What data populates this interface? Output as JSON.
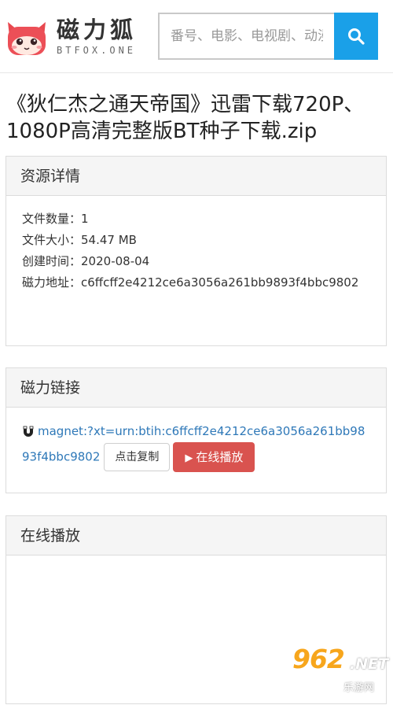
{
  "header": {
    "logo_name": "磁力狐",
    "logo_sub": "BTFOX.ONE",
    "search_placeholder": "番号、电影、电视剧、动漫"
  },
  "title": "《狄仁杰之通天帝国》迅雷下载720P、1080P高清完整版BT种子下载.zip",
  "details": {
    "heading": "资源详情",
    "rows": [
      {
        "label": "文件数量：",
        "value": "1"
      },
      {
        "label": "文件大小：",
        "value": "54.47 MB"
      },
      {
        "label": "创建时间：",
        "value": "2020-08-04"
      },
      {
        "label": "磁力地址：",
        "value": "c6ffcff2e4212ce6a3056a261bb9893f4bbc9802"
      }
    ]
  },
  "magnet": {
    "heading": "磁力链接",
    "link": "magnet:?xt=urn:btih:c6ffcff2e4212ce6a3056a261bb9893f4bbc9802",
    "copy_label": "点击复制",
    "play_label": "在线播放"
  },
  "online": {
    "heading": "在线播放"
  },
  "watermark": {
    "number": "962",
    "net": ".NET",
    "sub": "乐游网"
  },
  "colors": {
    "accent": "#1aa0e8",
    "link": "#2e78b8",
    "danger": "#d9534f",
    "watermark": "#f7a61c"
  }
}
